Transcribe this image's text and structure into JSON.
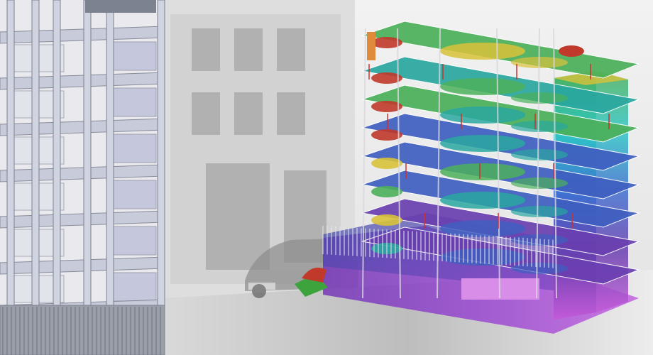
{
  "scene": {
    "panels": [
      "structural-wireframe-model",
      "street-photo-background",
      "fem-contour-analysis-model"
    ],
    "colors": {
      "wireframe": "#7d8290",
      "wireframe_fill": "#c5c8d8",
      "contour_red": "#c0392b",
      "contour_orange": "#e08a3c",
      "contour_yellow": "#d8c23a",
      "contour_green": "#4cb05a",
      "contour_teal": "#2aa7a0",
      "contour_blue": "#3f5fc0",
      "contour_violet": "#6a3fb0",
      "contour_magenta": "#b04fc8",
      "support_red": "#d03030"
    }
  }
}
